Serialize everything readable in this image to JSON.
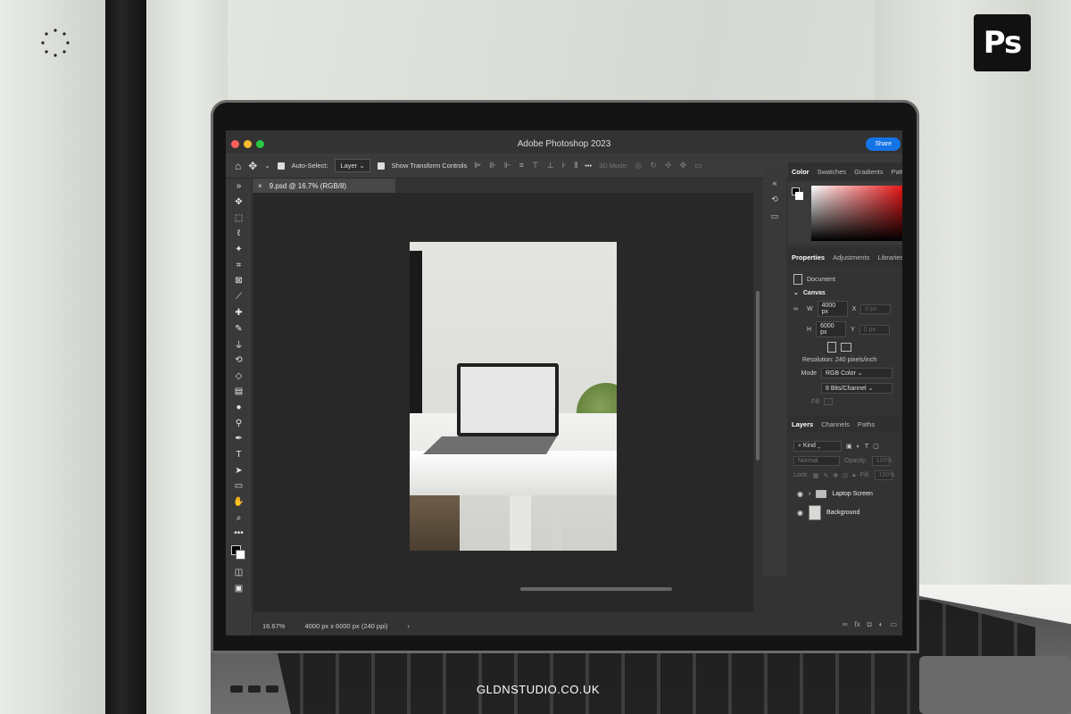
{
  "watermark": "GLDNSTUDIO.CO.UK",
  "logo": {
    "text": "Ps",
    "icon": "photoshop-logo-icon"
  },
  "app": {
    "title": "Adobe Photoshop 2023",
    "share_label": "Share",
    "window_controls": [
      "close-icon",
      "minimize-icon",
      "maximize-icon"
    ]
  },
  "options_bar": {
    "auto_select_label": "Auto-Select:",
    "auto_select_value": "Layer",
    "show_transform_label": "Show Transform Controls",
    "more_label": "•••",
    "mode_3d_label": "3D Mode:"
  },
  "document": {
    "tab_label": "9.psd @ 16.7% (RGB/8)",
    "zoom": "16.67%",
    "dimensions": "4000 px x 6000 px (240 ppi)"
  },
  "toolbar": {
    "tools": [
      "move-tool-icon",
      "marquee-tool-icon",
      "lasso-tool-icon",
      "magic-wand-icon",
      "crop-tool-icon",
      "frame-tool-icon",
      "eyedropper-icon",
      "healing-brush-icon",
      "brush-tool-icon",
      "clone-stamp-icon",
      "history-brush-icon",
      "eraser-icon",
      "gradient-tool-icon",
      "blur-tool-icon",
      "dodge-tool-icon",
      "pen-tool-icon",
      "type-tool-icon",
      "path-selection-icon",
      "rectangle-tool-icon",
      "hand-tool-icon",
      "zoom-tool-icon",
      "more-tools-icon"
    ],
    "type_glyph": "T",
    "more_glyph": "•••"
  },
  "color_panel": {
    "tabs": [
      "Color",
      "Swatches",
      "Gradients",
      "Patt"
    ],
    "hue_color": "#e81616"
  },
  "properties_panel": {
    "tabs": [
      "Properties",
      "Adjustments",
      "Libraries"
    ],
    "document_label": "Document",
    "canvas_label": "Canvas",
    "w_label": "W",
    "w_value": "4000 px",
    "h_label": "H",
    "h_value": "6000 px",
    "x_label": "X",
    "x_value": "0 px",
    "y_label": "Y",
    "y_value": "0 px",
    "resolution": "Resolution: 240 pixels/inch",
    "mode_label": "Mode",
    "mode_value": "RGB Color",
    "bits_value": "8 Bits/Channel",
    "fill_label": "Fill"
  },
  "layers_panel": {
    "tabs": [
      "Layers",
      "Channels",
      "Paths"
    ],
    "filter_kind": "Kind",
    "blend_mode": "Normal",
    "opacity_label": "Opacity:",
    "opacity_value": "100%",
    "lock_label": "Lock:",
    "fill_label": "Fill:",
    "fill_value": "100%",
    "layers": [
      {
        "name": "Laptop Screen",
        "type": "group"
      },
      {
        "name": "Background",
        "type": "image"
      }
    ]
  },
  "colors": {
    "accent": "#1473e6",
    "panel_bg": "#333333",
    "canvas_bg": "#282828"
  }
}
